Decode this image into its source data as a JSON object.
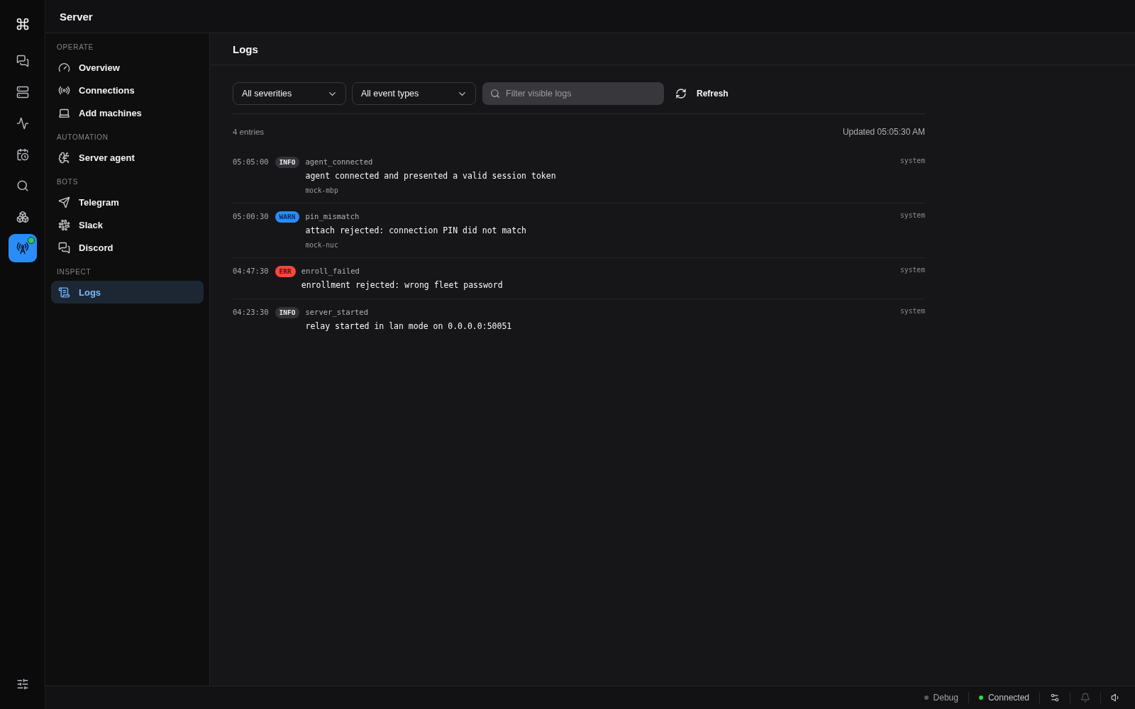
{
  "rail": {
    "items": [
      {
        "selected": false,
        "online": false
      },
      {
        "selected": false,
        "online": false
      },
      {
        "selected": false,
        "online": false
      },
      {
        "selected": false,
        "online": false
      },
      {
        "selected": false,
        "online": false
      },
      {
        "selected": false,
        "online": false
      },
      {
        "selected": true,
        "online": true
      }
    ],
    "footer_items": [
      {
        "selected": false
      }
    ]
  },
  "top_bar": {
    "title": "Server"
  },
  "sidebar": {
    "sections": [
      {
        "label": "OPERATE",
        "items": [
          {
            "label": "Overview",
            "selected": false
          },
          {
            "label": "Connections",
            "selected": false
          },
          {
            "label": "Add machines",
            "selected": false
          }
        ]
      },
      {
        "label": "AUTOMATION",
        "items": [
          {
            "label": "Server agent",
            "selected": false
          }
        ]
      },
      {
        "label": "BOTS",
        "items": [
          {
            "label": "Telegram",
            "selected": false
          },
          {
            "label": "Slack",
            "selected": false
          },
          {
            "label": "Discord",
            "selected": false
          }
        ]
      },
      {
        "label": "INSPECT",
        "items": [
          {
            "label": "Logs",
            "selected": true
          }
        ]
      }
    ]
  },
  "page": {
    "title": "Logs"
  },
  "toolbar": {
    "severity_filter": {
      "value": "All severities"
    },
    "event_type_filter": {
      "value": "All event types"
    },
    "search": {
      "placeholder": "Filter visible logs"
    },
    "refresh": {
      "label": "Refresh"
    }
  },
  "summary": {
    "count": "4 entries",
    "updated": "Updated 05:05:30 AM"
  },
  "entries": [
    {
      "time": "05:05:00",
      "severity": "INFO",
      "kind": "info",
      "event": "agent_connected",
      "message": "agent connected and presented a valid session token",
      "host": "mock-mbp",
      "source": "system"
    },
    {
      "time": "05:00:30",
      "severity": "WARN",
      "kind": "warn",
      "event": "pin_mismatch",
      "message": "attach rejected: connection PIN did not match",
      "host": "mock-nuc",
      "source": "system"
    },
    {
      "time": "04:47:30",
      "severity": "ERR",
      "kind": "err",
      "event": "enroll_failed",
      "message": "enrollment rejected: wrong fleet password",
      "source": "system"
    },
    {
      "time": "04:23:30",
      "severity": "INFO",
      "kind": "info",
      "event": "server_started",
      "message": "relay started in lan mode on 0.0.0.0:50051",
      "source": "system"
    }
  ],
  "status_bar": {
    "indicators": [
      {
        "label": "Debug",
        "color": "#5c5c60"
      },
      {
        "label": "Connected",
        "color": "#32d74b"
      }
    ],
    "buttons": [
      {
        "disabled": false
      },
      {
        "disabled": true
      },
      {
        "disabled": false
      }
    ]
  }
}
